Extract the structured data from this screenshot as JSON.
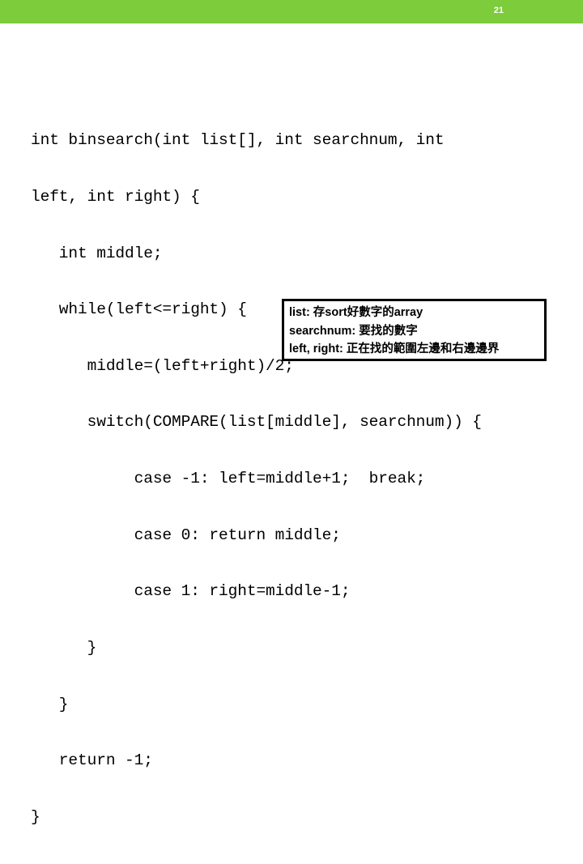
{
  "slide": {
    "page_number": "21",
    "accent_color": "#7dcc3c",
    "background_color": "#ffffff",
    "text_color": "#000000"
  },
  "code": {
    "language": "c",
    "lines": [
      "int binsearch(int list[], int searchnum, int",
      "left, int right) {",
      "   int middle;",
      "   while(left<=right) {",
      "      middle=(left+right)/2;",
      "      switch(COMPARE(list[middle], searchnum)) {",
      "           case -1: left=middle+1;  break;",
      "           case 0: return middle;",
      "           case 1: right=middle-1;",
      "      }",
      "   }",
      "   return -1;",
      "}"
    ]
  },
  "annotation": {
    "lines": [
      "list: 存sort好數字的array",
      "searchnum: 要找的數字",
      "left, right: 正在找的範圍左邊和右邊邊界"
    ]
  }
}
